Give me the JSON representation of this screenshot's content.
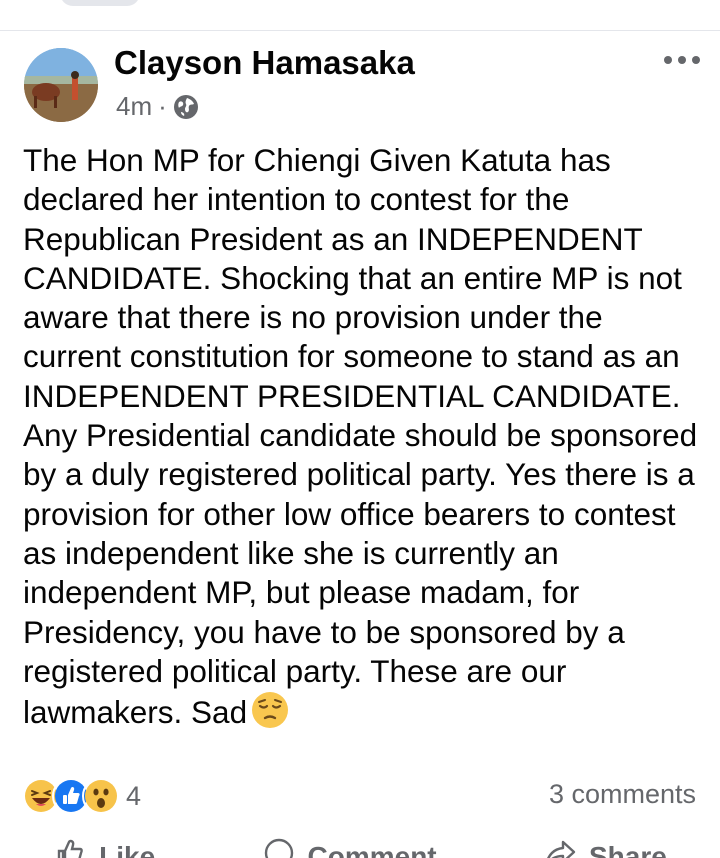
{
  "post": {
    "author": "Clayson Hamasaka",
    "time": "4m",
    "separator": "·",
    "audience_icon": "globe-icon",
    "more_icon": "more-options-icon",
    "text": "The Hon MP for Chiengi Given Katuta has declared her intention to contest for the Republican President as an INDEPENDENT CANDIDATE. Shocking that an entire MP is not aware that there is no provision under the current constitution for someone to stand as an INDEPENDENT PRESIDENTIAL CANDIDATE. Any Presidential candidate should be sponsored by a duly registered political party. Yes there is a provision for other low office bearers to contest as independent like she is currently an independent MP,  but please madam, for Presidency, you have to be sponsored by a registered political party. These are our lawmakers. Sad",
    "trailing_emoji": "pensive-face-emoji"
  },
  "stats": {
    "reactions": [
      "haha-reaction-icon",
      "like-reaction-icon",
      "wow-reaction-icon"
    ],
    "reaction_count": "4",
    "comments": "3 comments"
  },
  "actions": [
    {
      "name": "like-button",
      "icon": "thumbs-up-icon",
      "label": "Like"
    },
    {
      "name": "comment-button",
      "icon": "comment-icon",
      "label": "Comment"
    },
    {
      "name": "share-button",
      "icon": "share-icon",
      "label": "Share"
    }
  ],
  "colors": {
    "text": "#050505",
    "secondary": "#65676b",
    "like_blue": "#1877f2",
    "reaction_yellow": "#f7c34a"
  }
}
